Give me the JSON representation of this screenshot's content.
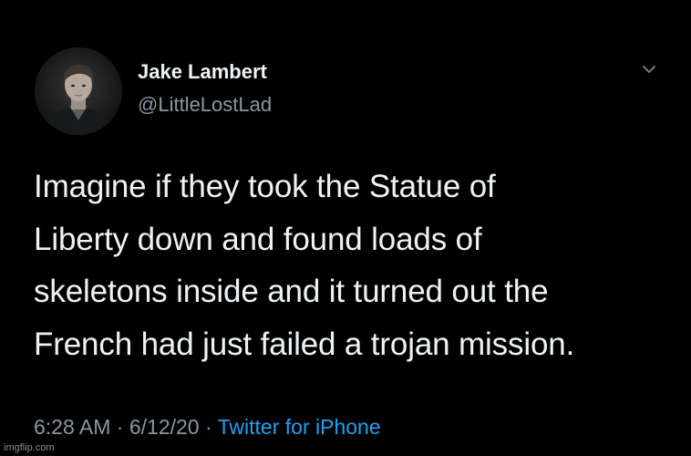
{
  "tweet": {
    "author": {
      "name": "Jake Lambert",
      "handle": "@LittleLostLad",
      "avatar_icon": "profile-photo"
    },
    "menu_icon": "chevron-down-icon",
    "text": "Imagine if they took the Statue of\nLiberty down and found loads of\nskeletons inside and it turned out the\nFrench had just failed a trojan mission.",
    "time": "6:28 AM",
    "date": "6/12/20",
    "separator": "·",
    "source": "Twitter for iPhone"
  },
  "watermark": "imgflip.com",
  "colors": {
    "background": "#000000",
    "text": "#eef2f5",
    "muted": "#8a96a3",
    "link": "#1da1f2"
  }
}
